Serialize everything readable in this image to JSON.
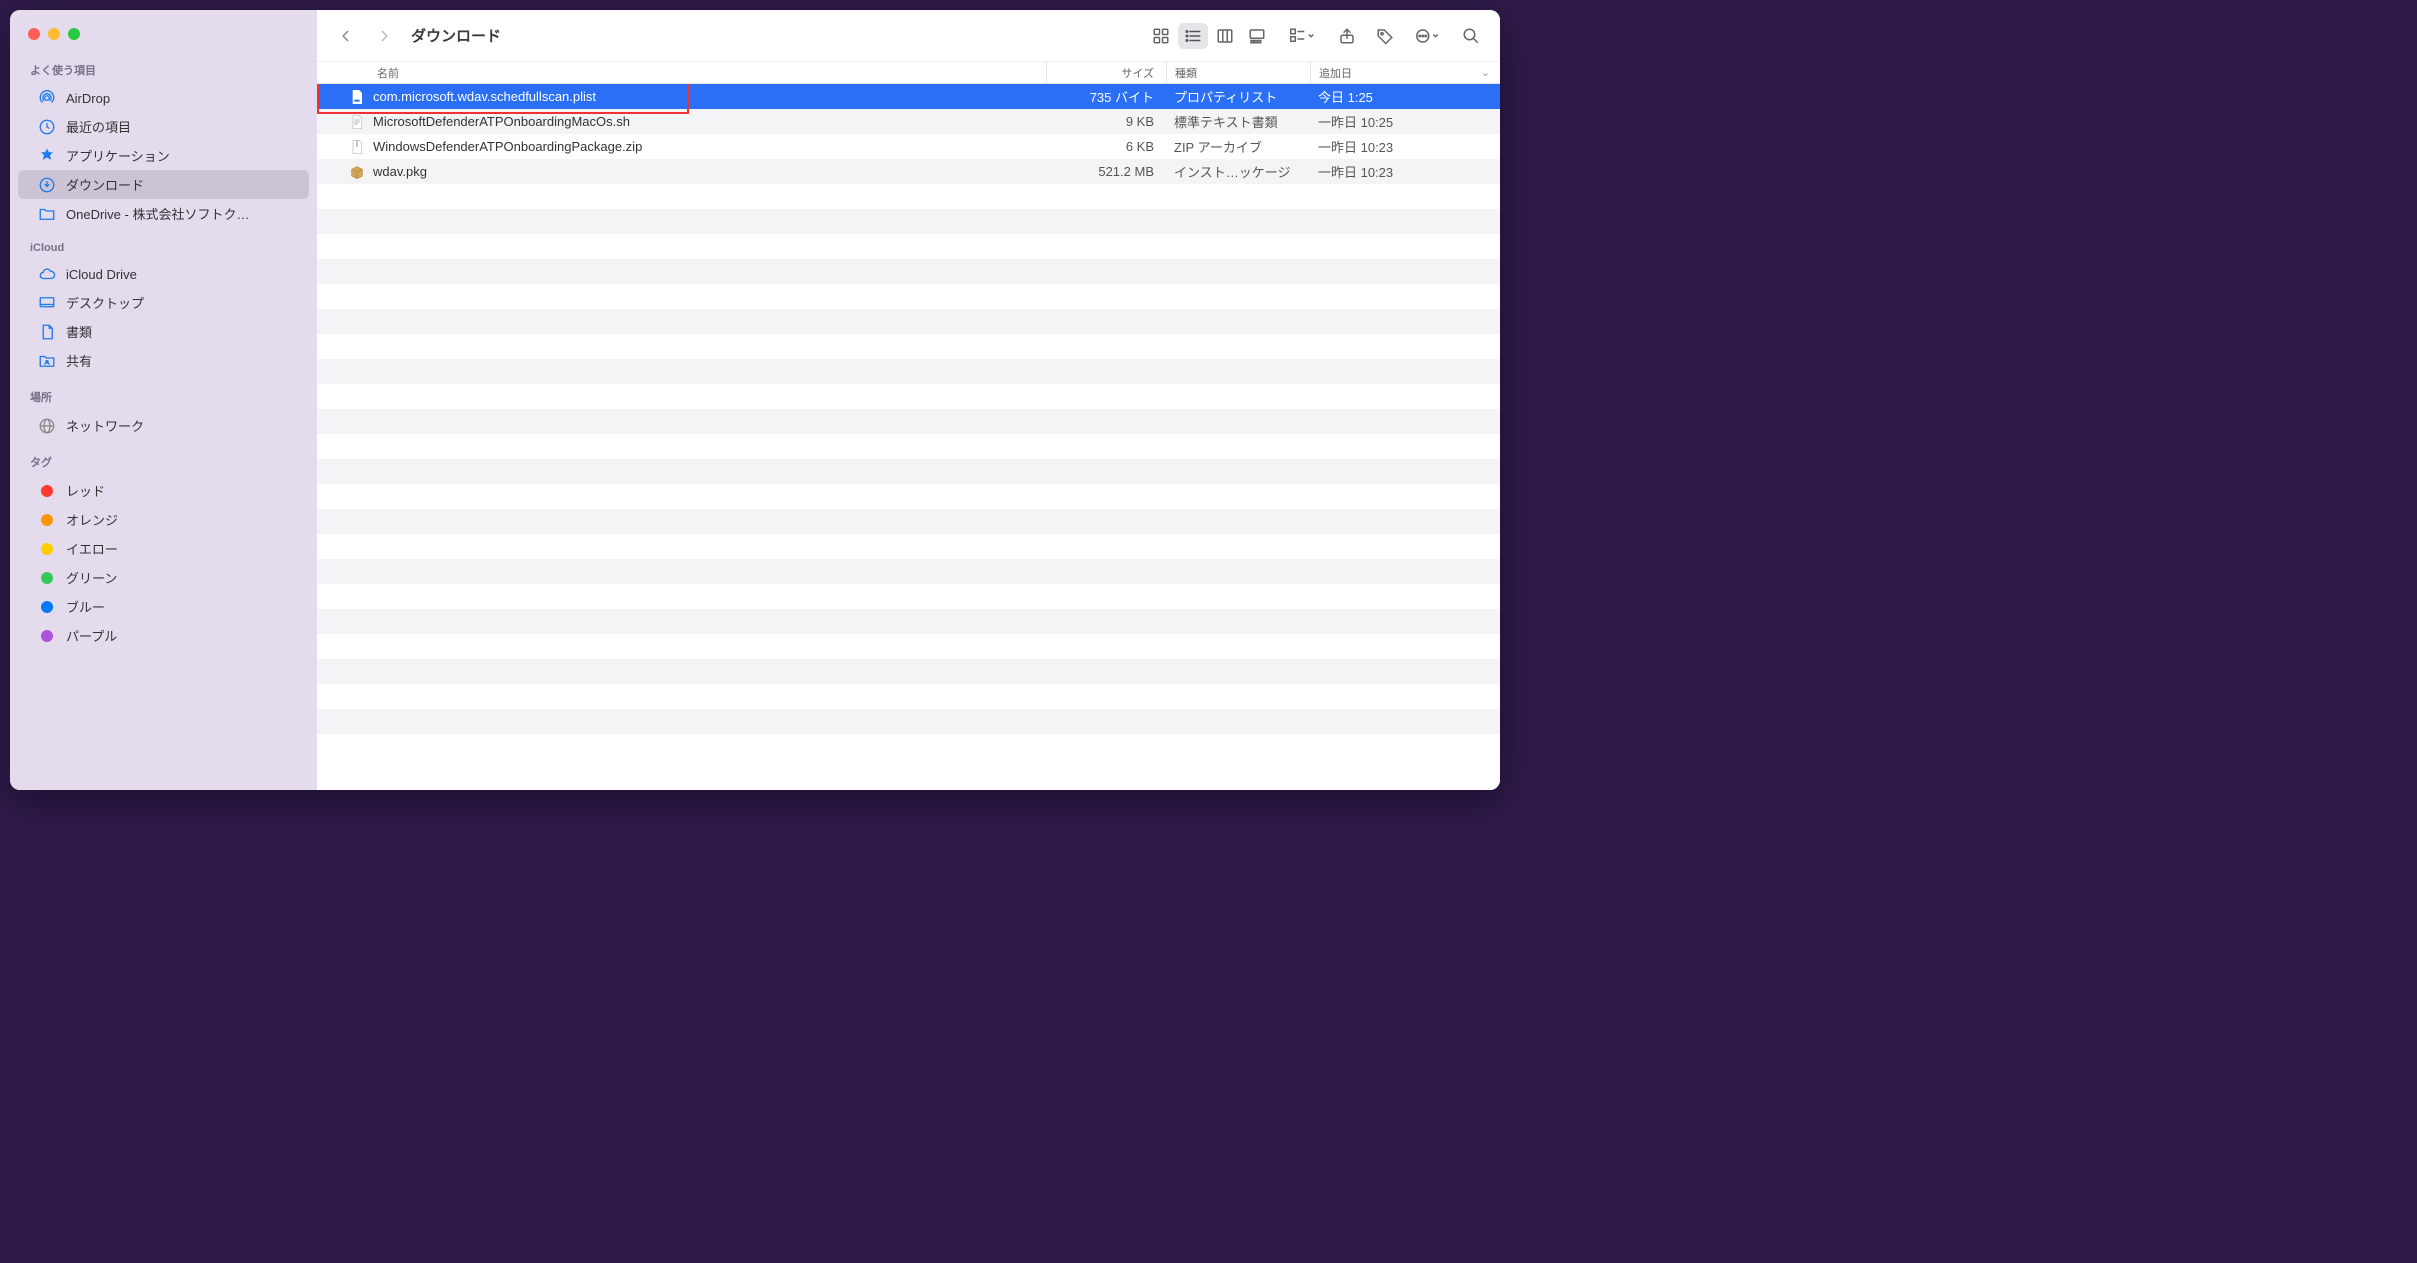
{
  "window_title": "ダウンロード",
  "sidebar": {
    "sections": [
      {
        "heading": "よく使う項目",
        "items": [
          {
            "icon": "airdrop",
            "label": "AirDrop"
          },
          {
            "icon": "clock",
            "label": "最近の項目"
          },
          {
            "icon": "apps",
            "label": "アプリケーション"
          },
          {
            "icon": "download",
            "label": "ダウンロード",
            "active": true
          },
          {
            "icon": "folder",
            "label": "OneDrive - 株式会社ソフトク…"
          }
        ]
      },
      {
        "heading": "iCloud",
        "items": [
          {
            "icon": "cloud",
            "label": "iCloud Drive"
          },
          {
            "icon": "desktop",
            "label": "デスクトップ"
          },
          {
            "icon": "doc",
            "label": "書類"
          },
          {
            "icon": "share-folder",
            "label": "共有"
          }
        ]
      },
      {
        "heading": "場所",
        "items": [
          {
            "icon": "globe",
            "label": "ネットワーク"
          }
        ]
      },
      {
        "heading": "タグ",
        "items": [
          {
            "icon": "tag",
            "color": "#ff3b30",
            "label": "レッド"
          },
          {
            "icon": "tag",
            "color": "#ff9500",
            "label": "オレンジ"
          },
          {
            "icon": "tag",
            "color": "#ffcc00",
            "label": "イエロー"
          },
          {
            "icon": "tag",
            "color": "#34c759",
            "label": "グリーン"
          },
          {
            "icon": "tag",
            "color": "#007aff",
            "label": "ブルー"
          },
          {
            "icon": "tag",
            "color": "#af52de",
            "label": "パープル"
          }
        ]
      }
    ]
  },
  "columns": {
    "name": "名前",
    "size": "サイズ",
    "kind": "種類",
    "date": "追加日"
  },
  "files": [
    {
      "icon": "plist",
      "name": "com.microsoft.wdav.schedfullscan.plist",
      "size": "735 バイト",
      "kind": "プロパティリスト",
      "date": "今日 1:25",
      "selected": true,
      "highlight": true
    },
    {
      "icon": "text",
      "name": "MicrosoftDefenderATPOnboardingMacOs.sh",
      "size": "9 KB",
      "kind": "標準テキスト書類",
      "date": "一昨日 10:25"
    },
    {
      "icon": "zip",
      "name": "WindowsDefenderATPOnboardingPackage.zip",
      "size": "6 KB",
      "kind": "ZIP アーカイブ",
      "date": "一昨日 10:23"
    },
    {
      "icon": "pkg",
      "name": "wdav.pkg",
      "size": "521.2 MB",
      "kind": "インスト…ッケージ",
      "date": "一昨日 10:23"
    }
  ]
}
